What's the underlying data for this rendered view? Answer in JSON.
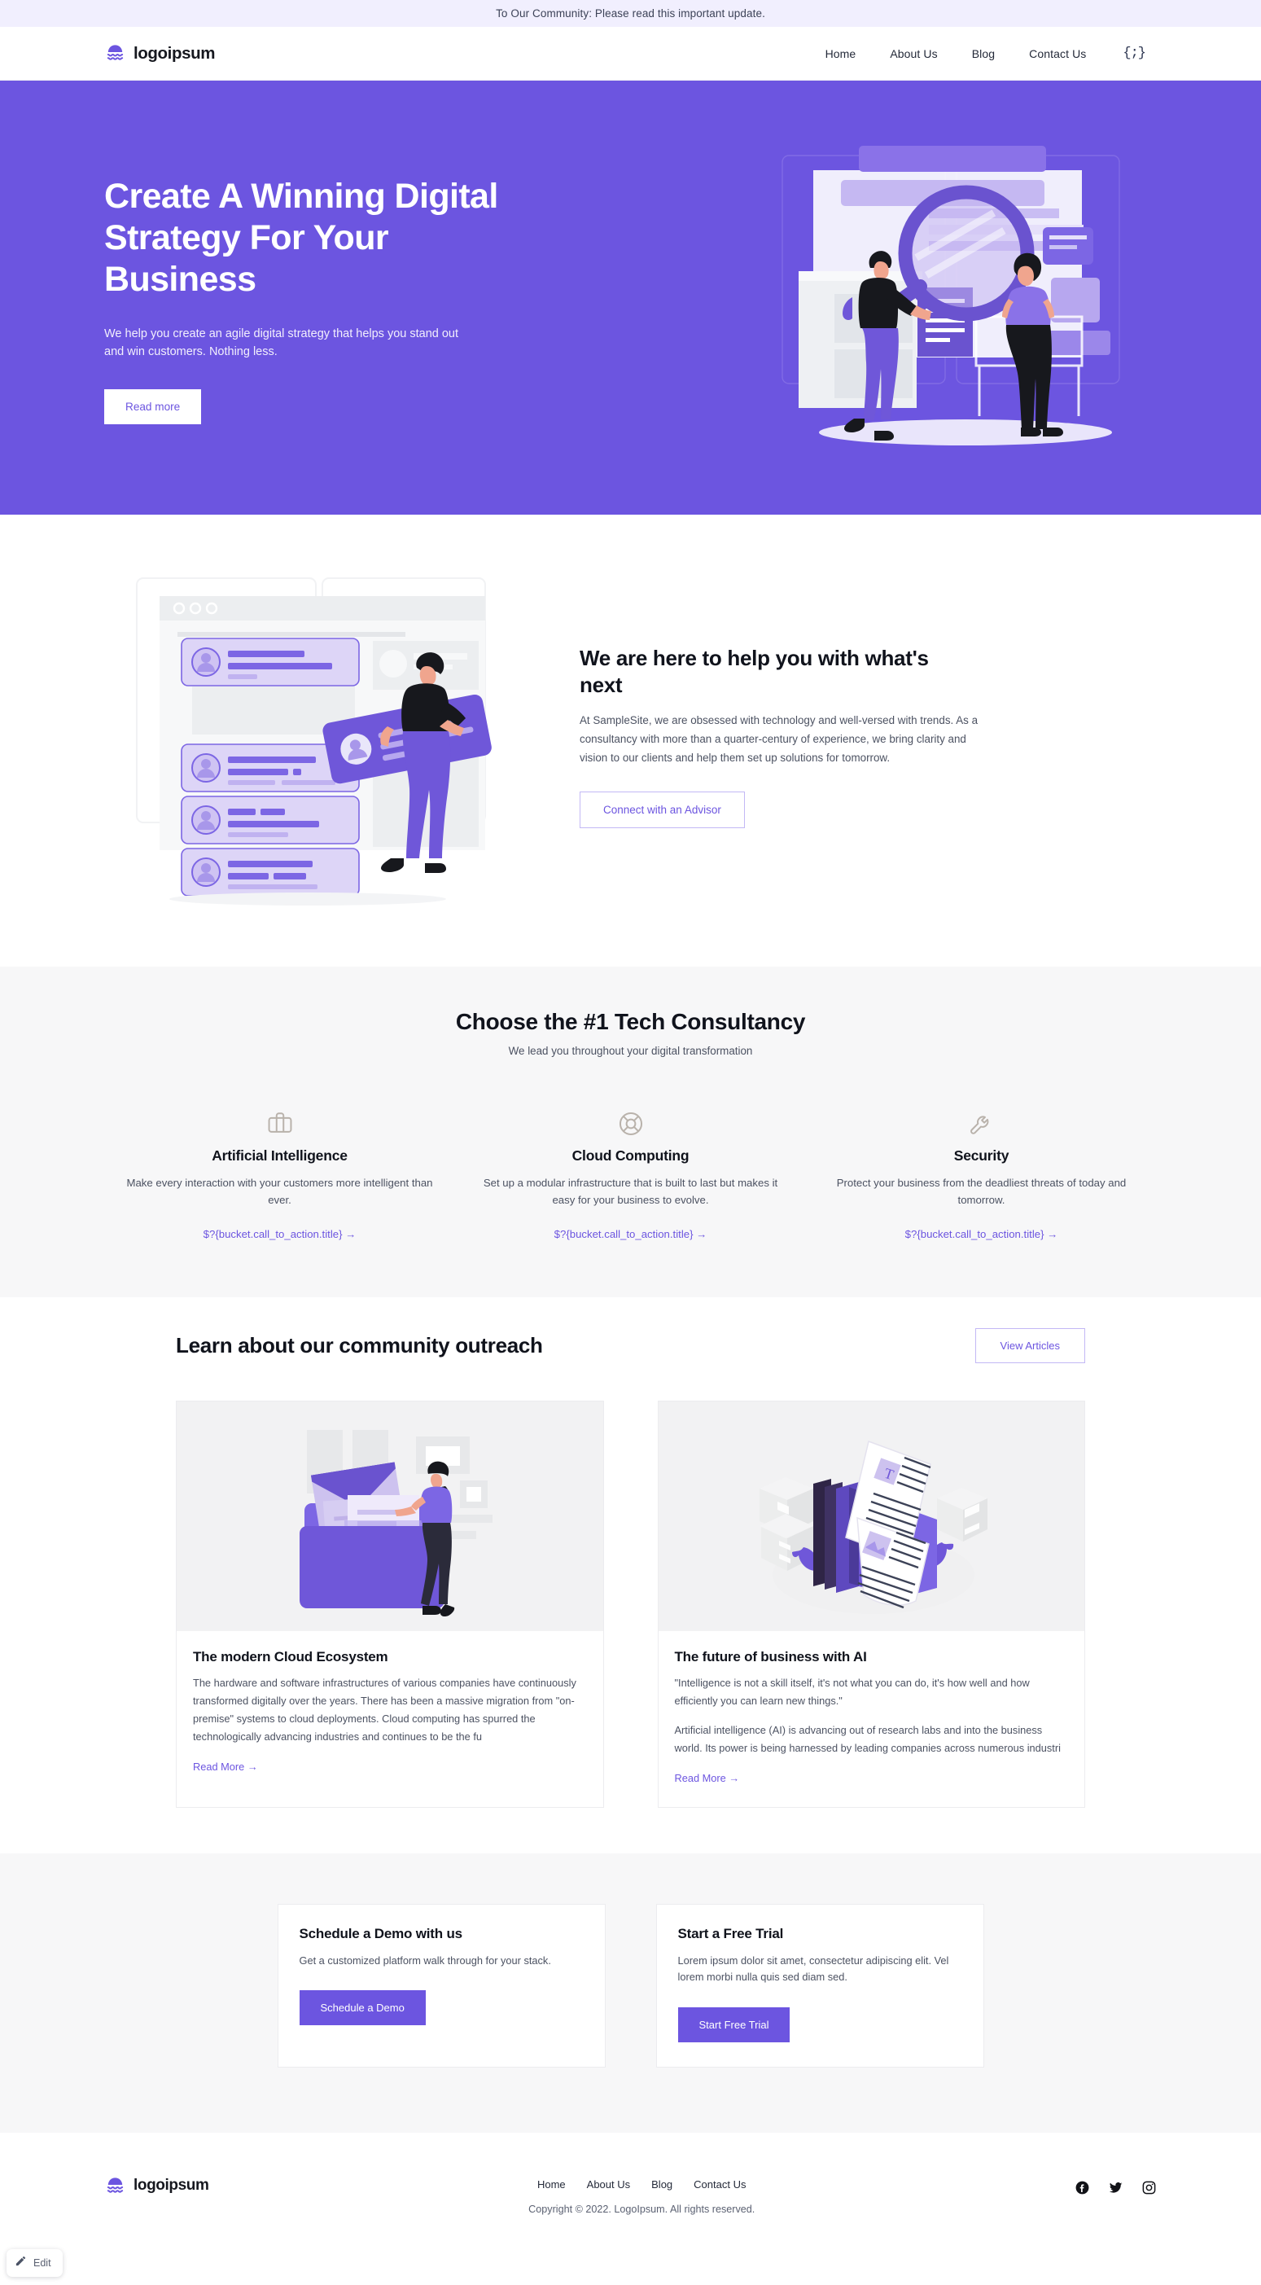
{
  "announcement": {
    "text": "To Our Community: Please read this important update."
  },
  "brand": {
    "name": "logoipsum",
    "logo_icon": "sun-waves-logo-icon",
    "accent": "#6c55e0"
  },
  "nav": {
    "items": [
      {
        "label": "Home"
      },
      {
        "label": "About Us"
      },
      {
        "label": "Blog"
      },
      {
        "label": "Contact Us"
      }
    ],
    "code_icon_label": "{;}"
  },
  "hero": {
    "heading": "Create A Winning Digital Strategy For Your Business",
    "subheading": "We help you create an agile digital strategy that helps you stand out and win customers. Nothing less.",
    "cta_label": "Read more",
    "bg": "#6c55e0",
    "illustration": "two-people-with-magnifier-illustration"
  },
  "help": {
    "heading": "We are here to help you with what's next",
    "body": "At SampleSite, we are obsessed with technology and well-versed with trends. As a consultancy with more than a quarter-century of experience, we bring clarity and vision to our clients and help them set up solutions for tomorrow.",
    "cta_label": "Connect with an Advisor",
    "illustration": "person-carrying-list-card-illustration"
  },
  "features": {
    "heading": "Choose the #1 Tech Consultancy",
    "subheading": "We lead you throughout your digital transformation",
    "items": [
      {
        "icon": "briefcase-icon",
        "title": "Artificial Intelligence",
        "body": "Make every interaction with your customers more intelligent than ever.",
        "link": "$?{bucket.call_to_action.title} →"
      },
      {
        "icon": "lifebuoy-icon",
        "title": "Cloud Computing",
        "body": "Set up a modular infrastructure that is built to last but makes it easy for your business to evolve.",
        "link": "$?{bucket.call_to_action.title} →"
      },
      {
        "icon": "wrench-icon",
        "title": "Security",
        "body": "Protect your business from the deadliest threats of today and tomorrow.",
        "link": "$?{bucket.call_to_action.title} →"
      }
    ]
  },
  "articles": {
    "heading": "Learn about our community outreach",
    "view_all_label": "View Articles",
    "items": [
      {
        "image": "woman-with-folder-documents-illustration",
        "title": "The modern Cloud Ecosystem",
        "body": "The hardware and software infrastructures of various companies have continuously transformed digitally over the years. There has been a massive migration from \"on-premise\" systems to cloud deployments. Cloud computing has spurred the technologically advancing industries and continues to be the fu",
        "body2": "",
        "read_more": "Read More →"
      },
      {
        "image": "isometric-folders-newspapers-illustration",
        "title": "The future of business with AI",
        "body": "\"Intelligence is not a skill itself, it's not what you can do, it's how well and how efficiently you can learn new things.\"",
        "body2": "Artificial intelligence (AI) is advancing out of research labs and into the business world. Its power is being harnessed by leading companies across numerous industri",
        "read_more": "Read More →"
      }
    ]
  },
  "cta": {
    "cards": [
      {
        "title": "Schedule a Demo with us",
        "body": "Get a customized platform walk through for your stack.",
        "button": "Schedule a Demo"
      },
      {
        "title": "Start a Free Trial",
        "body": "Lorem ipsum dolor sit amet, consectetur adipiscing elit. Vel lorem morbi nulla quis sed diam sed.",
        "button": "Start Free Trial"
      }
    ]
  },
  "footer": {
    "brand_name": "logoipsum",
    "links": [
      {
        "label": "Home"
      },
      {
        "label": "About Us"
      },
      {
        "label": "Blog"
      },
      {
        "label": "Contact Us"
      }
    ],
    "copyright": "Copyright © 2022. LogoIpsum. All rights reserved.",
    "socials": [
      {
        "icon": "facebook-icon"
      },
      {
        "icon": "twitter-icon"
      },
      {
        "icon": "instagram-icon"
      }
    ]
  },
  "overlay": {
    "edit_label": "Edit",
    "edit_icon": "pencil-icon"
  }
}
